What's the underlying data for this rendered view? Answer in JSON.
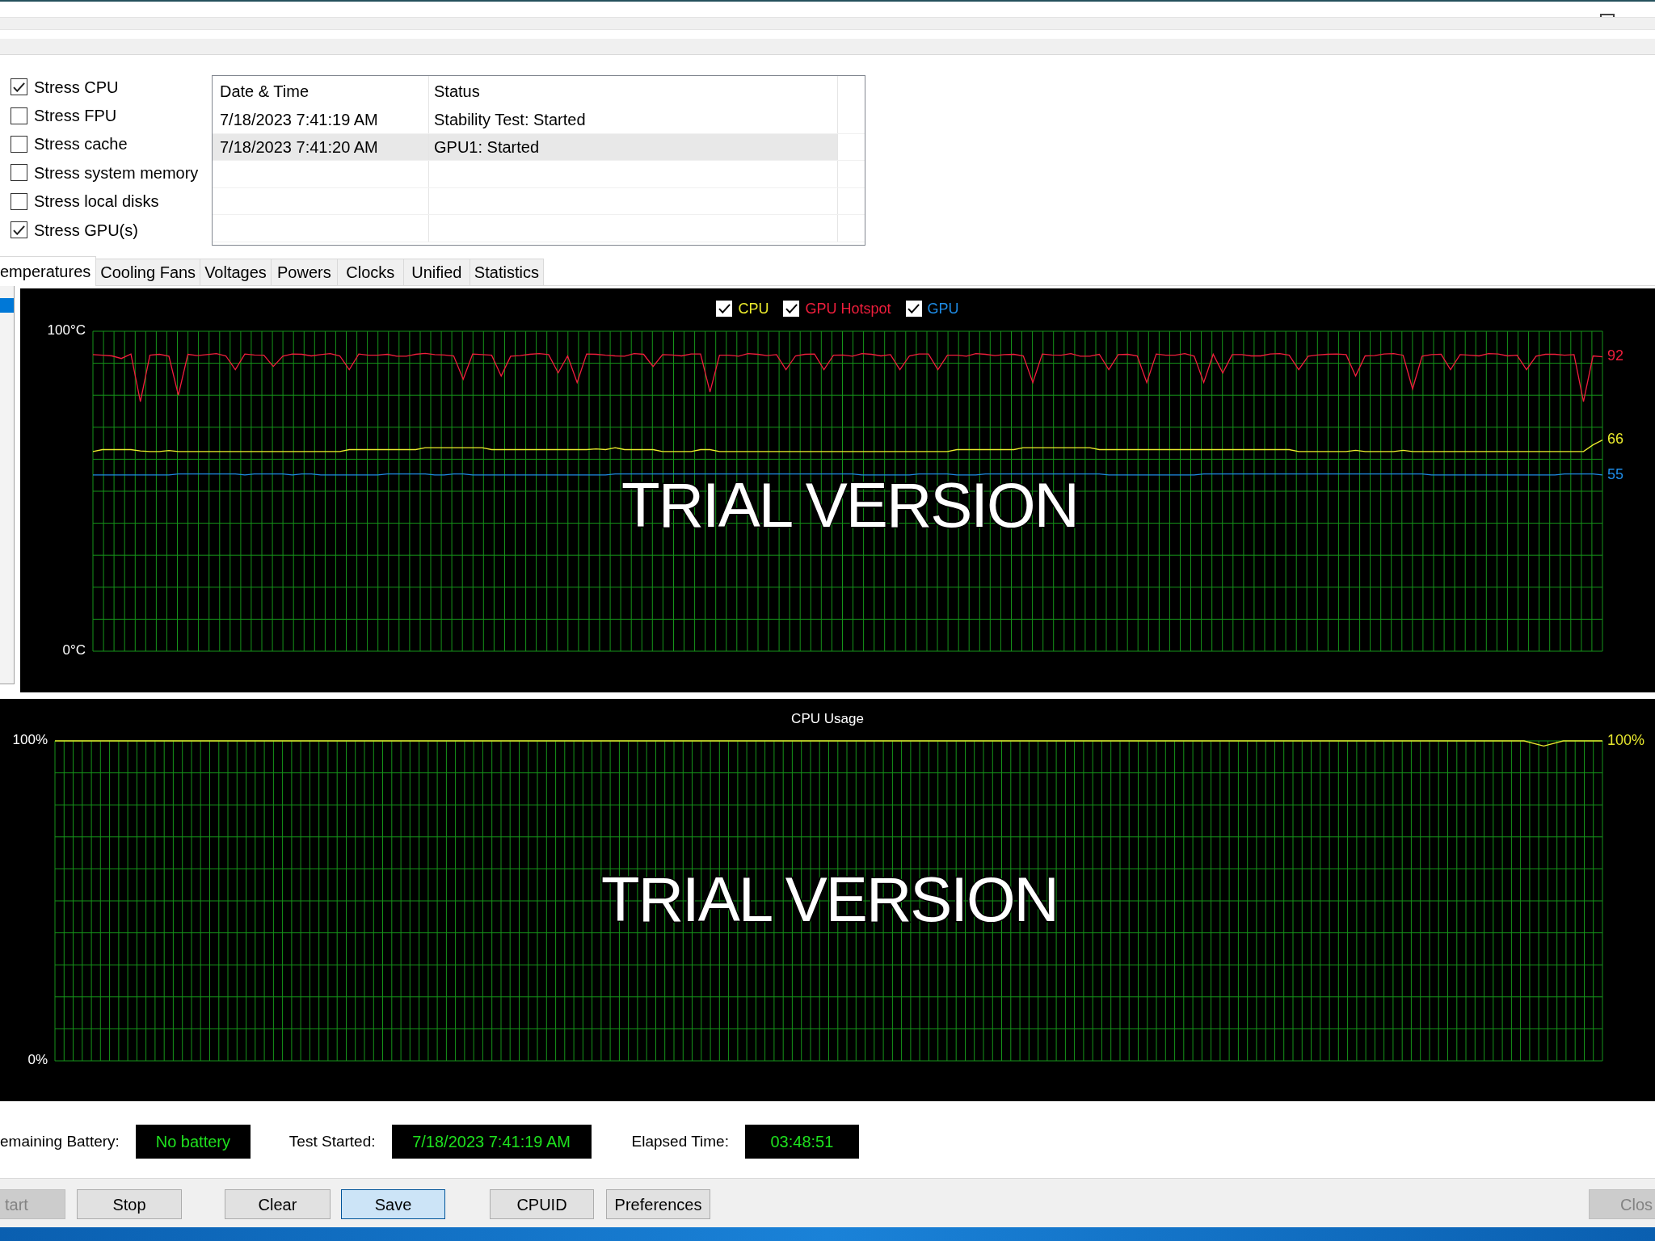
{
  "stress_options": [
    {
      "label": "Stress CPU",
      "checked": true
    },
    {
      "label": "Stress FPU",
      "checked": false
    },
    {
      "label": "Stress cache",
      "checked": false
    },
    {
      "label": "Stress system memory",
      "checked": false
    },
    {
      "label": "Stress local disks",
      "checked": false
    },
    {
      "label": "Stress GPU(s)",
      "checked": true
    }
  ],
  "log_table": {
    "columns": [
      "Date & Time",
      "Status"
    ],
    "rows": [
      {
        "cells": [
          "7/18/2023 7:41:19 AM",
          "Stability Test: Started"
        ],
        "selected": false
      },
      {
        "cells": [
          "7/18/2023 7:41:20 AM",
          "GPU1: Started"
        ],
        "selected": true
      }
    ]
  },
  "tabs": [
    {
      "label": "emperatures",
      "selected": true
    },
    {
      "label": "Cooling Fans",
      "selected": false
    },
    {
      "label": "Voltages",
      "selected": false
    },
    {
      "label": "Powers",
      "selected": false
    },
    {
      "label": "Clocks",
      "selected": false
    },
    {
      "label": "Unified",
      "selected": false
    },
    {
      "label": "Statistics",
      "selected": false
    }
  ],
  "side_list": [
    {
      "selected": true
    }
  ],
  "temperature_chart": {
    "legend": [
      {
        "checked": true
      },
      {
        "checked": true
      },
      {
        "checked": true
      }
    ],
    "watermark": "TRIAL VERSION",
    "chart_data": {
      "type": "line",
      "grid": true,
      "ylim": [
        0,
        100
      ],
      "yticks": [
        {
          "value": 100,
          "label": "100°C"
        },
        {
          "value": 0,
          "label": "0°C"
        }
      ],
      "series": [
        {
          "name": "CPU",
          "color": "#ebeb2d",
          "values": [
            62.4,
            63,
            63,
            63,
            63,
            62.6,
            62.4,
            62.4,
            62.7,
            62.4,
            62.4,
            62.4,
            62.4,
            62.4,
            62.4,
            62.4,
            62.4,
            62.4,
            62.4,
            62.4,
            62.4,
            62.4,
            62.4,
            62.4,
            62.4,
            62.4,
            62.4,
            63,
            63,
            63,
            63,
            63,
            63,
            63,
            63,
            63.6,
            63.6,
            63.6,
            63.6,
            63.6,
            63.6,
            63.6,
            63,
            63,
            63,
            63,
            63,
            63,
            63,
            63,
            63,
            63,
            63,
            63.2,
            63,
            63.6,
            63,
            63,
            63,
            63,
            62.4,
            62.4,
            62.4,
            62.4,
            63,
            63,
            62.4,
            62.4,
            62.4,
            62.4,
            62.4,
            62.4,
            62.4,
            62.4,
            62.4,
            62.4,
            62.4,
            62.4,
            62.4,
            62.4,
            62.4,
            62.4,
            62.4,
            62.4,
            62.4,
            62.4,
            62.4,
            62.4,
            62.4,
            62.4,
            62.4,
            63,
            63,
            63,
            63,
            63,
            63,
            63,
            63.6,
            63.6,
            63.6,
            63.6,
            63.6,
            63.6,
            63.6,
            63.6,
            63,
            63,
            63,
            63,
            63,
            63,
            63,
            63,
            63,
            63,
            63,
            63,
            63,
            63,
            63,
            63,
            63,
            63,
            63,
            63,
            63,
            62.4,
            62.4,
            62.4,
            62.4,
            62.4,
            62.4,
            62.8,
            62.4,
            62.4,
            62.4,
            62.4,
            62.8,
            62.4,
            62.4,
            62.4,
            62.4,
            62.4,
            62.4,
            62.4,
            62.4,
            62.4,
            62.4,
            62.4,
            62.4,
            62.4,
            62.4,
            62.4,
            62.4,
            62.4,
            62.4,
            62.4,
            64.5,
            66
          ]
        },
        {
          "name": "GPU Hotspot",
          "color": "#f01e3c",
          "values": [
            92.7,
            92.5,
            92.3,
            91.5,
            92.9,
            78,
            92.5,
            92.8,
            92.2,
            80,
            92.8,
            92.4,
            92.7,
            93,
            92.3,
            88,
            92.9,
            92.6,
            92.5,
            89,
            92.2,
            92.9,
            92.8,
            92.3,
            92.7,
            93,
            92.3,
            88,
            92.9,
            92.5,
            92.5,
            92.8,
            92.2,
            92.2,
            92.8,
            93.1,
            92.7,
            92.6,
            92.3,
            85,
            92.9,
            92.7,
            92.5,
            86,
            92.2,
            92.4,
            92.8,
            93,
            92.7,
            87,
            92.3,
            84,
            92.9,
            92.8,
            92.5,
            92.3,
            92.2,
            93,
            92.8,
            89,
            92.7,
            92.6,
            92.3,
            92.9,
            92.9,
            81,
            92.5,
            92.5,
            92.2,
            93,
            92.8,
            92.4,
            92.7,
            88,
            92.3,
            92.8,
            92.9,
            88,
            92.5,
            92.6,
            92.2,
            93,
            92.8,
            92.3,
            92.7,
            88,
            92.3,
            92.9,
            92.9,
            88,
            92.5,
            92.5,
            92.2,
            93,
            92.8,
            92.4,
            92.7,
            92.8,
            92.3,
            84,
            92.9,
            92.6,
            92.5,
            93,
            92.2,
            92.2,
            92.8,
            88,
            92.7,
            92.8,
            92.3,
            84,
            92.9,
            92.5,
            92.5,
            93,
            92.2,
            84,
            92.8,
            87,
            92.7,
            92.7,
            92.3,
            92.3,
            92.9,
            93,
            92.5,
            88,
            92.2,
            92.6,
            92.8,
            92.9,
            92.7,
            86,
            92.3,
            92.4,
            92.9,
            93,
            92.5,
            82,
            92.2,
            92.7,
            92.8,
            88,
            92.7,
            92.5,
            92.3,
            93,
            92.9,
            92.3,
            92.5,
            88,
            92.2,
            92.8,
            92.8,
            92.5,
            92.7,
            78,
            92.3,
            92
          ]
        },
        {
          "name": "GPU",
          "color": "#1e8ce6",
          "values": [
            55.1,
            55.1,
            55.1,
            55.1,
            55.1,
            55.1,
            55.1,
            55.1,
            55.1,
            55.4,
            55.4,
            55.4,
            55.4,
            55.4,
            55.4,
            55.4,
            55.1,
            55.4,
            55.4,
            55.4,
            55.4,
            55.1,
            55.4,
            55.4,
            55.1,
            55.1,
            55.1,
            55.1,
            55.1,
            55.1,
            55.1,
            55.4,
            55.4,
            55.4,
            55.4,
            55.4,
            55.1,
            55.1,
            55.4,
            55.4,
            55.1,
            55.1,
            55.1,
            55.1,
            55.1,
            55.1,
            55.1,
            55.1,
            55.1,
            55.1,
            55.1,
            55.1,
            55.1,
            55.1,
            55.1,
            55.4,
            55.4,
            55.4,
            55.4,
            55.4,
            55.4,
            55.4,
            55.4,
            55.4,
            55.4,
            55.4,
            55.4,
            55.4,
            55.4,
            55.4,
            55.4,
            55.4,
            55.4,
            55.4,
            55.4,
            55.4,
            55.4,
            55.4,
            55.4,
            55.4,
            55.4,
            55.1,
            55.1,
            55.1,
            55.1,
            55.1,
            55.1,
            55.4,
            55.4,
            55.4,
            55.4,
            55.1,
            55.1,
            55.1,
            55.4,
            55.4,
            55.4,
            55.4,
            55.4,
            55.4,
            55.4,
            55.4,
            55.4,
            55.4,
            55.4,
            55.4,
            55.4,
            55.1,
            55.1,
            55.1,
            55.1,
            55.1,
            55.1,
            55.1,
            55.1,
            55.1,
            55.1,
            55.4,
            55.4,
            55.4,
            55.4,
            55.4,
            55.4,
            55.4,
            55.4,
            55.4,
            55.4,
            55.4,
            55.4,
            55.4,
            55.4,
            55.4,
            55.4,
            55.4,
            55.4,
            55.4,
            55.4,
            55.4,
            55.4,
            55.4,
            55.4,
            55.1,
            55.1,
            55.1,
            55.1,
            55.1,
            55.1,
            55.1,
            55.1,
            55.1,
            55.1,
            55.1,
            55.1,
            55.1,
            55.1,
            55.4,
            55.4,
            55.4,
            55.4,
            55.1
          ]
        }
      ],
      "annotations": [
        "66",
        "92",
        "55"
      ]
    }
  },
  "cpu_usage_chart": {
    "watermark": "TRIAL VERSION",
    "chart_data": {
      "type": "line",
      "title": "CPU Usage",
      "grid": true,
      "ylim": [
        0,
        100
      ],
      "yticks": [
        {
          "value": 100,
          "label": "100%"
        },
        {
          "value": 0,
          "label": "0%"
        }
      ],
      "series": [
        {
          "color": "#e6e62e",
          "values": [
            100,
            100,
            100,
            100,
            100,
            100,
            100,
            100,
            100,
            100,
            100,
            100,
            100,
            100,
            100,
            100,
            100,
            100,
            100,
            100,
            100,
            100,
            100,
            100,
            100,
            100,
            100,
            100,
            100,
            100,
            100,
            100,
            100,
            100,
            100,
            100,
            100,
            100,
            100,
            100,
            100,
            100,
            100,
            100,
            100,
            100,
            100,
            100,
            100,
            100,
            100,
            100,
            100,
            100,
            100,
            100,
            100,
            100,
            100,
            100,
            100,
            100,
            100,
            100,
            100,
            100,
            100,
            100,
            100,
            100,
            100,
            100,
            100,
            100,
            100,
            100,
            98.4,
            100,
            100,
            100
          ]
        }
      ],
      "annotations": [
        "100%"
      ]
    }
  },
  "status_fields": [
    {
      "label": "emaining Battery:",
      "value": "No battery"
    },
    {
      "label": "Test Started:",
      "value": "7/18/2023 7:41:19 AM"
    },
    {
      "label": "Elapsed Time:",
      "value": "03:48:51"
    }
  ],
  "buttons": [
    {
      "label": "tart",
      "disabled": true,
      "focused": false
    },
    {
      "label": "Stop",
      "disabled": false,
      "focused": false
    },
    {
      "label": "Clear",
      "disabled": false,
      "focused": false
    },
    {
      "label": "Save",
      "disabled": false,
      "focused": true
    },
    {
      "label": "CPUID",
      "disabled": false,
      "focused": false
    },
    {
      "label": "Preferences",
      "disabled": false,
      "focused": false
    },
    {
      "label": "Clos",
      "disabled": true,
      "focused": false
    }
  ]
}
